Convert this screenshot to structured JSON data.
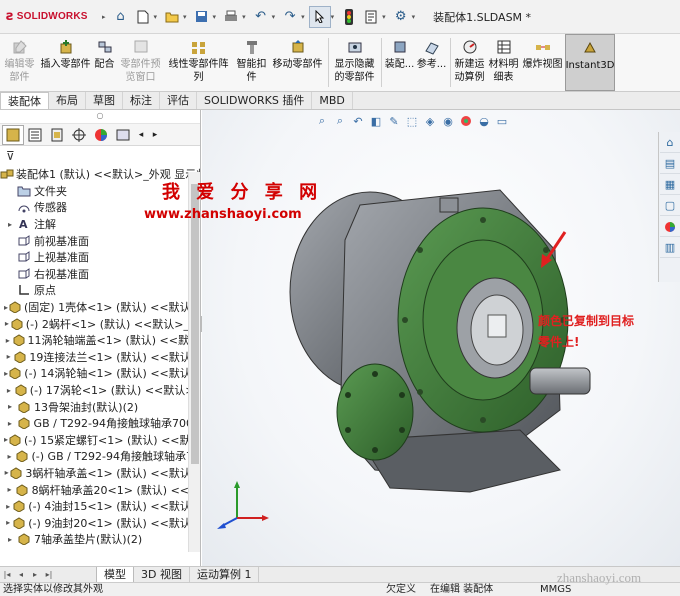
{
  "titlebar": {
    "brand_mark": "ƨ",
    "brand_name": "SOLIDWORKS",
    "document_title": "装配体1.SLDASM *"
  },
  "ribbon": {
    "buttons": [
      {
        "label": "编辑零\n部件",
        "disabled": true,
        "icon": "edit-component-icon"
      },
      {
        "label": "插入零部件",
        "disabled": false,
        "icon": "insert-component-icon"
      },
      {
        "label": "配合",
        "disabled": false,
        "icon": "mate-icon"
      },
      {
        "label": "零部件预\n览窗口",
        "disabled": true,
        "icon": "component-preview-icon"
      },
      {
        "label": "线性零部件阵列",
        "disabled": false,
        "icon": "linear-pattern-icon"
      },
      {
        "label": "智能扣\n件",
        "disabled": false,
        "icon": "smart-fastener-icon"
      },
      {
        "label": "移动零部件",
        "disabled": false,
        "icon": "move-component-icon"
      },
      {
        "label": "显示隐藏\n的零部件",
        "disabled": false,
        "icon": "show-hidden-icon"
      },
      {
        "label": "装配...",
        "disabled": false,
        "icon": "assembly-features-icon"
      },
      {
        "label": "参考...",
        "disabled": false,
        "icon": "reference-geometry-icon"
      },
      {
        "label": "新建运\n动算例",
        "disabled": false,
        "icon": "new-motion-study-icon"
      },
      {
        "label": "材料明\n细表",
        "disabled": false,
        "icon": "bom-icon"
      },
      {
        "label": "爆炸视图",
        "disabled": false,
        "icon": "exploded-view-icon"
      },
      {
        "label": "Instant3D",
        "disabled": false,
        "active": true,
        "icon": "instant3d-icon"
      }
    ]
  },
  "command_tabs": [
    "装配体",
    "布局",
    "草图",
    "标注",
    "评估",
    "SOLIDWORKS 插件",
    "MBD"
  ],
  "active_command_tab": "装配体",
  "feature_tree": {
    "filter_icon": "filter-icon",
    "items": [
      {
        "label": "装配体1 (默认) <<默认>_外观 显示状",
        "icon": "assembly-icon",
        "expand": "",
        "indent": 0
      },
      {
        "label": "文件夹",
        "icon": "folder-icon",
        "expand": "",
        "indent": 1
      },
      {
        "label": "传感器",
        "icon": "sensor-icon",
        "expand": "",
        "indent": 1
      },
      {
        "label": "注解",
        "icon": "annotation-icon",
        "expand": "▸",
        "indent": 1
      },
      {
        "label": "前视基准面",
        "icon": "plane-icon",
        "expand": "",
        "indent": 1
      },
      {
        "label": "上视基准面",
        "icon": "plane-icon",
        "expand": "",
        "indent": 1
      },
      {
        "label": "右视基准面",
        "icon": "plane-icon",
        "expand": "",
        "indent": 1
      },
      {
        "label": "原点",
        "icon": "origin-icon",
        "expand": "",
        "indent": 1
      },
      {
        "label": "(固定) 1壳体<1> (默认) <<默认>_",
        "icon": "part-icon",
        "expand": "▸",
        "indent": 1
      },
      {
        "label": "(-) 2蜗杆<1> (默认) <<默认>_显",
        "icon": "part-icon",
        "expand": "▸",
        "indent": 1
      },
      {
        "label": "11涡轮轴端盖<1> (默认) <<默认",
        "icon": "part-icon",
        "expand": "▸",
        "indent": 1
      },
      {
        "label": "19连接法兰<1> (默认) <<默认>",
        "icon": "part-icon",
        "expand": "▸",
        "indent": 1
      },
      {
        "label": "(-) 14涡轮轴<1> (默认) <<默认>",
        "icon": "part-icon",
        "expand": "▸",
        "indent": 1
      },
      {
        "label": "(-) 17涡轮<1> (默认) <<默认>_",
        "icon": "part-icon",
        "expand": "▸",
        "indent": 1
      },
      {
        "label": "13骨架油封(默认)(2)",
        "icon": "part-icon",
        "expand": "▸",
        "indent": 1
      },
      {
        "label": "GB / T292-94角接触球轴承7006",
        "icon": "part-icon",
        "expand": "▸",
        "indent": 1
      },
      {
        "label": "(-) 15紧定螺钉<1> (默认) <<默认",
        "icon": "part-icon",
        "expand": "▸",
        "indent": 1
      },
      {
        "label": "(-) GB / T292-94角接触球轴承73",
        "icon": "part-icon",
        "expand": "▸",
        "indent": 1
      },
      {
        "label": "3蜗杆轴承盖<1> (默认) <<默认>",
        "icon": "part-icon",
        "expand": "▸",
        "indent": 1
      },
      {
        "label": "8蜗杆轴承盖20<1> (默认) <<默",
        "icon": "part-icon",
        "expand": "▸",
        "indent": 1
      },
      {
        "label": "(-) 4油封15<1> (默认) <<默认>",
        "icon": "part-icon",
        "expand": "▸",
        "indent": 1
      },
      {
        "label": "(-) 9油封20<1> (默认) <<默认>",
        "icon": "part-icon",
        "expand": "▸",
        "indent": 1
      },
      {
        "label": "7轴承盖垫片(默认)(2)",
        "icon": "part-icon",
        "expand": "▸",
        "indent": 1
      }
    ]
  },
  "bottom_tabs": [
    "模型",
    "3D 视图",
    "运动算例 1"
  ],
  "active_bottom_tab": "模型",
  "status": {
    "left": "选择实体以修改其外观",
    "definition": "欠定义",
    "editing": "在编辑 装配体",
    "units": "MMGS"
  },
  "overlay": {
    "watermark_title": "我 爱 分 享 网",
    "watermark_url": "www.zhanshaoyi.com",
    "annotation_note": "颜色已复制到目标零件上!",
    "corner_watermark": "zhanshaoyi.com"
  },
  "colors": {
    "part_gray": "#6f7378",
    "flange_green": "#3f7d3a",
    "annotation_red": "#e02020",
    "brand_red": "#c8102e"
  }
}
